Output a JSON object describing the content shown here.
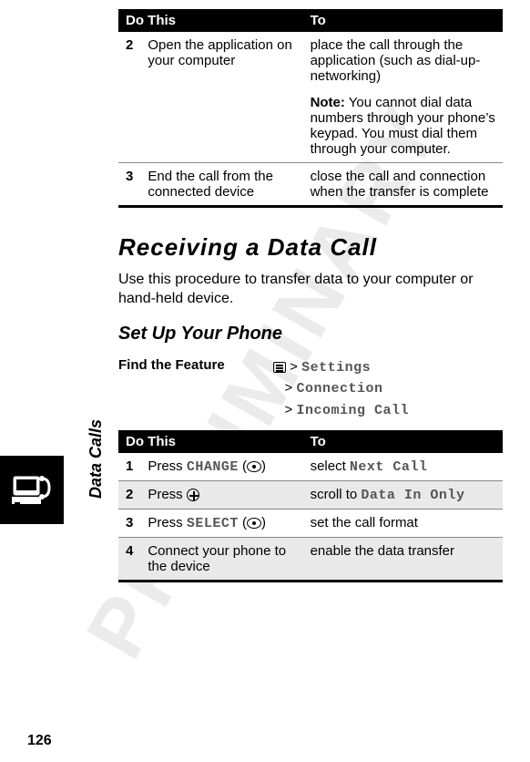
{
  "watermark": "PRELIMINARY",
  "side_label": "Data Calls",
  "page_number": "126",
  "table1": {
    "head_dothis": "Do This",
    "head_to": "To",
    "rows": [
      {
        "num": "2",
        "dothis": "Open the application on your computer",
        "to": "place the call through the application (such as dial-up-networking)",
        "note_label": "Note:",
        "note": " You cannot dial data numbers through your phone’s keypad. You must dial them through your computer."
      },
      {
        "num": "3",
        "dothis": "End the call from the connected device",
        "to": "close the call and connection when the transfer is complete"
      }
    ]
  },
  "section_title": "Receiving a Data Call",
  "section_body": "Use this procedure to transfer data to your computer or hand-held device.",
  "subheading": "Set Up Your Phone",
  "find": {
    "label": "Find the Feature",
    "gt": ">",
    "l1": "Settings",
    "l2": "Connection",
    "l3": "Incoming Call"
  },
  "table2": {
    "head_dothis": "Do This",
    "head_to": "To",
    "rows": [
      {
        "num": "1",
        "do_pre": "Press ",
        "do_key": "CHANGE",
        "do_post": " (",
        "do_close": ")",
        "to_pre": "select ",
        "to_key": "Next Call"
      },
      {
        "num": "2",
        "do_pre": "Press ",
        "to_pre": "scroll to ",
        "to_key": "Data In Only"
      },
      {
        "num": "3",
        "do_pre": "Press ",
        "do_key": "SELECT",
        "do_post": " (",
        "do_close": ")",
        "to_pre": "set the call format"
      },
      {
        "num": "4",
        "do_pre": "Connect your phone to the device",
        "to_pre": "enable the data transfer"
      }
    ]
  }
}
